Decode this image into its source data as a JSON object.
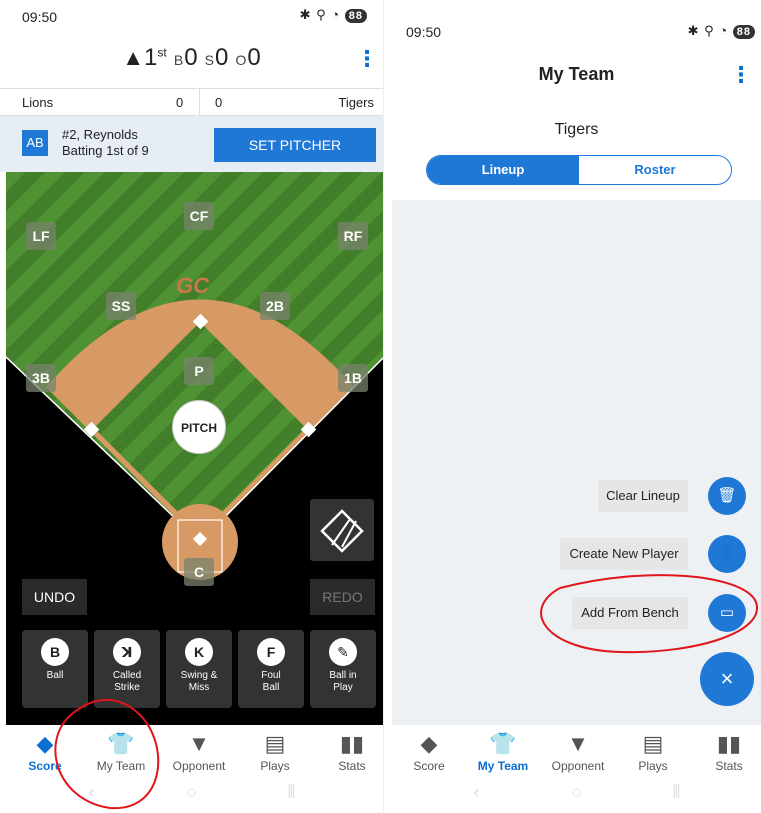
{
  "left": {
    "status": {
      "time": "09:50",
      "battery": "88"
    },
    "inning": {
      "arrow": "▲",
      "num": "1",
      "suffix": "st",
      "balls_label": "B",
      "balls": "0",
      "strikes_label": "S",
      "strikes": "0",
      "outs_label": "O",
      "outs": "0"
    },
    "score": {
      "away_team": "Lions",
      "away_runs": "0",
      "home_runs": "0",
      "home_team": "Tigers"
    },
    "batter": {
      "badge": "AB",
      "line1": "#2, Reynolds",
      "line2": "Batting 1st of 9",
      "set_pitcher": "SET PITCHER"
    },
    "field": {
      "watermark": "GC",
      "positions": [
        "CF",
        "LF",
        "RF",
        "SS",
        "2B",
        "P",
        "3B",
        "1B",
        "C"
      ],
      "pitch": "PITCH"
    },
    "undo": "UNDO",
    "redo": "REDO",
    "actions": [
      {
        "glyph": "B",
        "label1": "Ball",
        "label2": ""
      },
      {
        "glyph": "ꓘ",
        "label1": "Called",
        "label2": "Strike"
      },
      {
        "glyph": "K",
        "label1": "Swing &",
        "label2": "Miss"
      },
      {
        "glyph": "F",
        "label1": "Foul",
        "label2": "Ball"
      },
      {
        "glyph": "✎",
        "label1": "Ball in",
        "label2": "Play"
      }
    ],
    "nav": [
      "Score",
      "My Team",
      "Opponent",
      "Plays",
      "Stats"
    ]
  },
  "right": {
    "status": {
      "time": "09:50",
      "battery": "88"
    },
    "title": "My Team",
    "team": "Tigers",
    "tabs": [
      "Lineup",
      "Roster"
    ],
    "fab_menu": [
      "Clear Lineup",
      "Create New Player",
      "Add From Bench"
    ],
    "nav": [
      "Score",
      "My Team",
      "Opponent",
      "Plays",
      "Stats"
    ]
  },
  "colors": {
    "accent": "#1f78d6",
    "grass": "#4a8a2f",
    "dirt": "#d79a64",
    "annotation": "#e0161c"
  },
  "icons": {
    "nav": [
      "baseball-diamond-icon",
      "jersey-icon",
      "jersey-filled-icon",
      "scoreboard-icon",
      "stats-bars-icon"
    ]
  }
}
